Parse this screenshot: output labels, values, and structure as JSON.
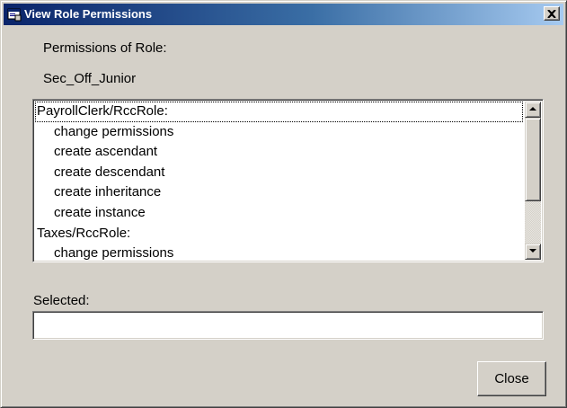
{
  "window": {
    "title": "View Role Permissions",
    "close_glyph": "×"
  },
  "labels": {
    "permissions_of_role": "Permissions of Role:",
    "role_name": "Sec_Off_Junior",
    "selected": "Selected:"
  },
  "permissions_list": {
    "items": [
      {
        "text": "PayrollClerk/RccRole:",
        "indent": false
      },
      {
        "text": "change permissions",
        "indent": true
      },
      {
        "text": "create ascendant",
        "indent": true
      },
      {
        "text": "create descendant",
        "indent": true
      },
      {
        "text": "create inheritance",
        "indent": true
      },
      {
        "text": "create instance",
        "indent": true
      },
      {
        "text": "Taxes/RccRole:",
        "indent": false
      },
      {
        "text": "change permissions",
        "indent": true
      }
    ]
  },
  "selected_field": {
    "value": ""
  },
  "buttons": {
    "close_label": "Close"
  },
  "icons": {
    "title_icon": "application-window-icon",
    "scroll_up": "arrow-up-icon",
    "scroll_down": "arrow-down-icon"
  },
  "colors": {
    "dialog_face": "#d4d0c8",
    "titlebar_start": "#0a246a",
    "titlebar_end": "#a6caf0"
  }
}
